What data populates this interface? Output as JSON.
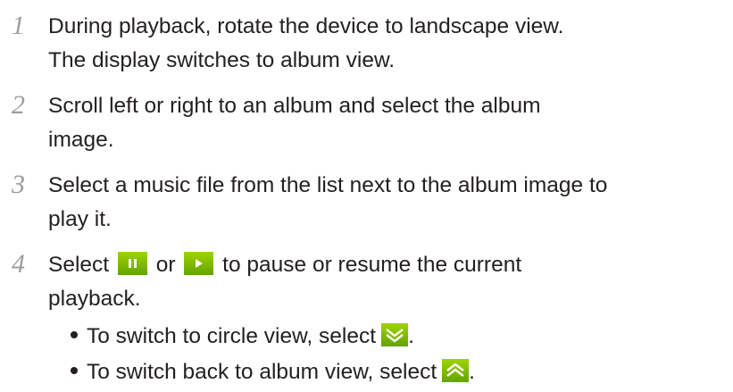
{
  "steps": [
    {
      "number": "1",
      "lines": [
        "During playback, rotate the device to landscape view.",
        "The display switches to album view."
      ]
    },
    {
      "number": "2",
      "lines": [
        "Scroll left or right to an album and select the album",
        "image."
      ]
    },
    {
      "number": "3",
      "lines": [
        "Select a music file from the list next to the album image to",
        "play it."
      ]
    },
    {
      "number": "4",
      "line1_before": "Select",
      "line1_middle": "or",
      "line1_after": "to pause or resume the current",
      "line2": "playback."
    }
  ],
  "bullets": [
    {
      "before": "To switch to circle view, select",
      "after": "."
    },
    {
      "before": "To switch back to album view, select",
      "after": "."
    }
  ],
  "icons": {
    "pause": "pause-icon",
    "play": "play-icon",
    "chevron_down": "double-chevron-down-icon",
    "chevron_up": "double-chevron-up-icon",
    "icon_green": "#7dbb00"
  }
}
